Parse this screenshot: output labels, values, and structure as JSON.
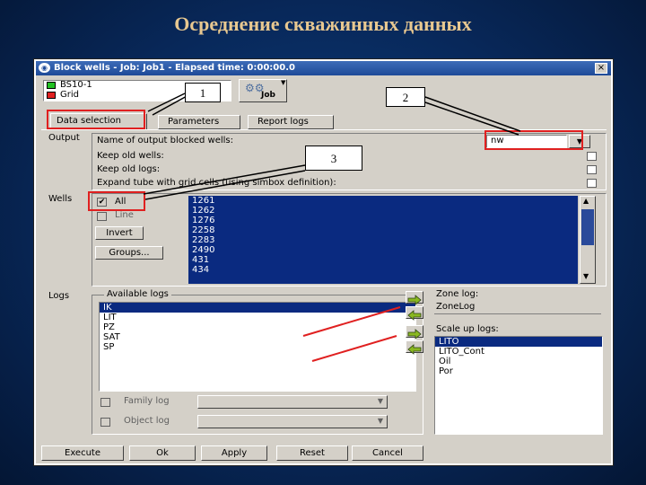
{
  "slide": {
    "title": "Осреднение скважинных данных"
  },
  "window": {
    "title": "Block wells - Job: Job1 - Elapsed time: 0:00:00.0",
    "close": "×",
    "grid_list": [
      {
        "label": "BS10-1",
        "color": "#22c022"
      },
      {
        "label": "Grid",
        "color": "#e02020"
      }
    ],
    "job_label": "Job"
  },
  "tabs": [
    {
      "label": "Data selection",
      "active": true
    },
    {
      "label": "Parameters",
      "active": false
    },
    {
      "label": "Report logs",
      "active": false
    }
  ],
  "output": {
    "section": "Output",
    "name_label": "Name of output blocked wells:",
    "name_value": "nw",
    "keep_wells": "Keep old wells:",
    "keep_logs": "Keep old logs:",
    "expand": "Expand tube with grid cells (using simbox definition):"
  },
  "wells": {
    "section": "Wells",
    "all": "All",
    "line": "Line",
    "invert": "Invert",
    "groups": "Groups...",
    "items": [
      "1261",
      "1262",
      "1276",
      "2258",
      "2283",
      "2490",
      "431",
      "434"
    ]
  },
  "logs": {
    "section": "Logs",
    "available_title": "Available logs",
    "available": [
      "IK",
      "LIT",
      "PZ",
      "SAT",
      "SP"
    ],
    "zone_label": "Zone log:",
    "zone_value": "ZoneLog",
    "scale_label": "Scale up logs:",
    "scale_items": [
      "LITO",
      "LITO_Cont",
      "Oil",
      "Por"
    ],
    "family": "Family log",
    "object": "Object log"
  },
  "buttons": {
    "execute": "Execute",
    "ok": "Ok",
    "apply": "Apply",
    "reset": "Reset",
    "cancel": "Cancel"
  },
  "callouts": [
    "1",
    "2",
    "3"
  ],
  "colors": {
    "annotation_red": "#e02020",
    "list_blue": "#0a2a80",
    "title_gold": "#e8c890"
  }
}
